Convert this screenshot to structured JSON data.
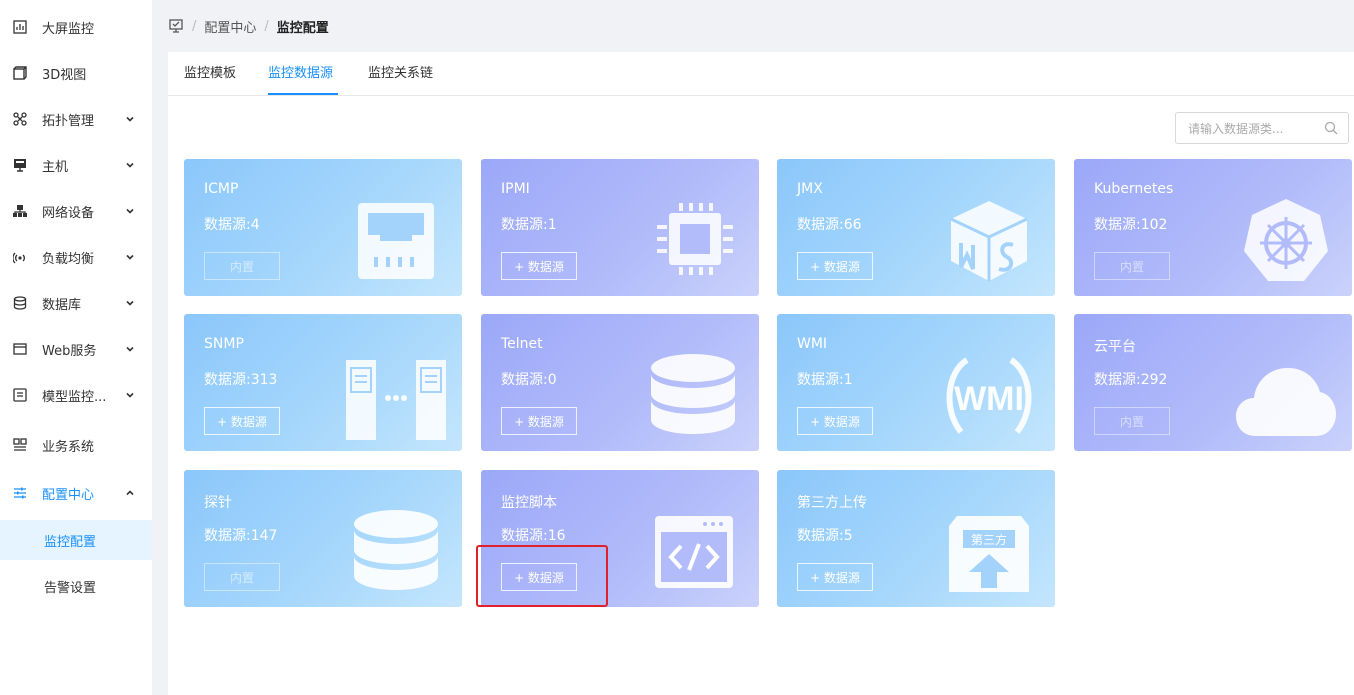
{
  "sidebar": {
    "items": [
      {
        "label": "大屏监控",
        "icon": "dashboard-icon",
        "expandable": false
      },
      {
        "label": "3D视图",
        "icon": "cube-icon",
        "expandable": false
      },
      {
        "label": "拓扑管理",
        "icon": "topology-icon",
        "expandable": true
      },
      {
        "label": "主机",
        "icon": "monitor-icon",
        "expandable": true
      },
      {
        "label": "网络设备",
        "icon": "network-device-icon",
        "expandable": true
      },
      {
        "label": "负载均衡",
        "icon": "signal-icon",
        "expandable": true
      },
      {
        "label": "数据库",
        "icon": "database-icon",
        "expandable": true
      },
      {
        "label": "Web服务",
        "icon": "browser-icon",
        "expandable": true
      },
      {
        "label": "模型监控...",
        "icon": "model-icon",
        "expandable": true
      },
      {
        "label": "业务系统",
        "icon": "business-icon",
        "expandable": false
      },
      {
        "label": "配置中心",
        "icon": "sliders-icon",
        "expandable": true,
        "expanded": true,
        "active": true
      }
    ],
    "sub_items": [
      {
        "label": "监控配置",
        "active": true
      },
      {
        "label": "告警设置",
        "active": false
      }
    ]
  },
  "breadcrumb": {
    "items": [
      "配置中心",
      "监控配置"
    ],
    "separator": "/"
  },
  "tabs": [
    {
      "label": "监控模板",
      "active": false
    },
    {
      "label": "监控数据源",
      "active": true
    },
    {
      "label": "监控关系链",
      "active": false
    }
  ],
  "search": {
    "placeholder": "请输入数据源类...",
    "value": ""
  },
  "count_prefix": "数据源:",
  "cards": [
    {
      "title": "ICMP",
      "count": "4",
      "button": "内置",
      "builtin": true,
      "theme": "blue",
      "icon": "network-port-icon"
    },
    {
      "title": "IPMI",
      "count": "1",
      "button": "+ 数据源",
      "builtin": false,
      "theme": "purple",
      "icon": "chip-icon"
    },
    {
      "title": "JMX",
      "count": "66",
      "button": "+ 数据源",
      "builtin": false,
      "theme": "blue",
      "icon": "jmx-cube-icon"
    },
    {
      "title": "Kubernetes",
      "count": "102",
      "button": "内置",
      "builtin": true,
      "theme": "purple",
      "icon": "helm-wheel-icon"
    },
    {
      "title": "SNMP",
      "count": "313",
      "button": "+ 数据源",
      "builtin": false,
      "theme": "blue",
      "icon": "servers-icon"
    },
    {
      "title": "Telnet",
      "count": "0",
      "button": "+ 数据源",
      "builtin": false,
      "theme": "purple",
      "icon": "database-icon"
    },
    {
      "title": "WMI",
      "count": "1",
      "button": "+ 数据源",
      "builtin": false,
      "theme": "blue",
      "icon": "wmi-logo-icon",
      "icon_text": "WMI"
    },
    {
      "title": "云平台",
      "count": "292",
      "button": "内置",
      "builtin": true,
      "theme": "purple",
      "icon": "cloud-icon"
    },
    {
      "title": "探针",
      "count": "147",
      "button": "内置",
      "builtin": true,
      "theme": "blue",
      "icon": "database-icon"
    },
    {
      "title": "监控脚本",
      "count": "16",
      "button": "+ 数据源",
      "builtin": false,
      "theme": "purple",
      "icon": "code-window-icon"
    },
    {
      "title": "第三方上传",
      "count": "5",
      "button": "+ 数据源",
      "builtin": false,
      "theme": "blue",
      "icon": "upload-box-icon",
      "icon_text": "第三方"
    }
  ],
  "colors": {
    "accent": "#1890ff",
    "highlight": "#e0202a",
    "card_blue": "#8bc7fb",
    "card_purple": "#9ba8f8"
  }
}
